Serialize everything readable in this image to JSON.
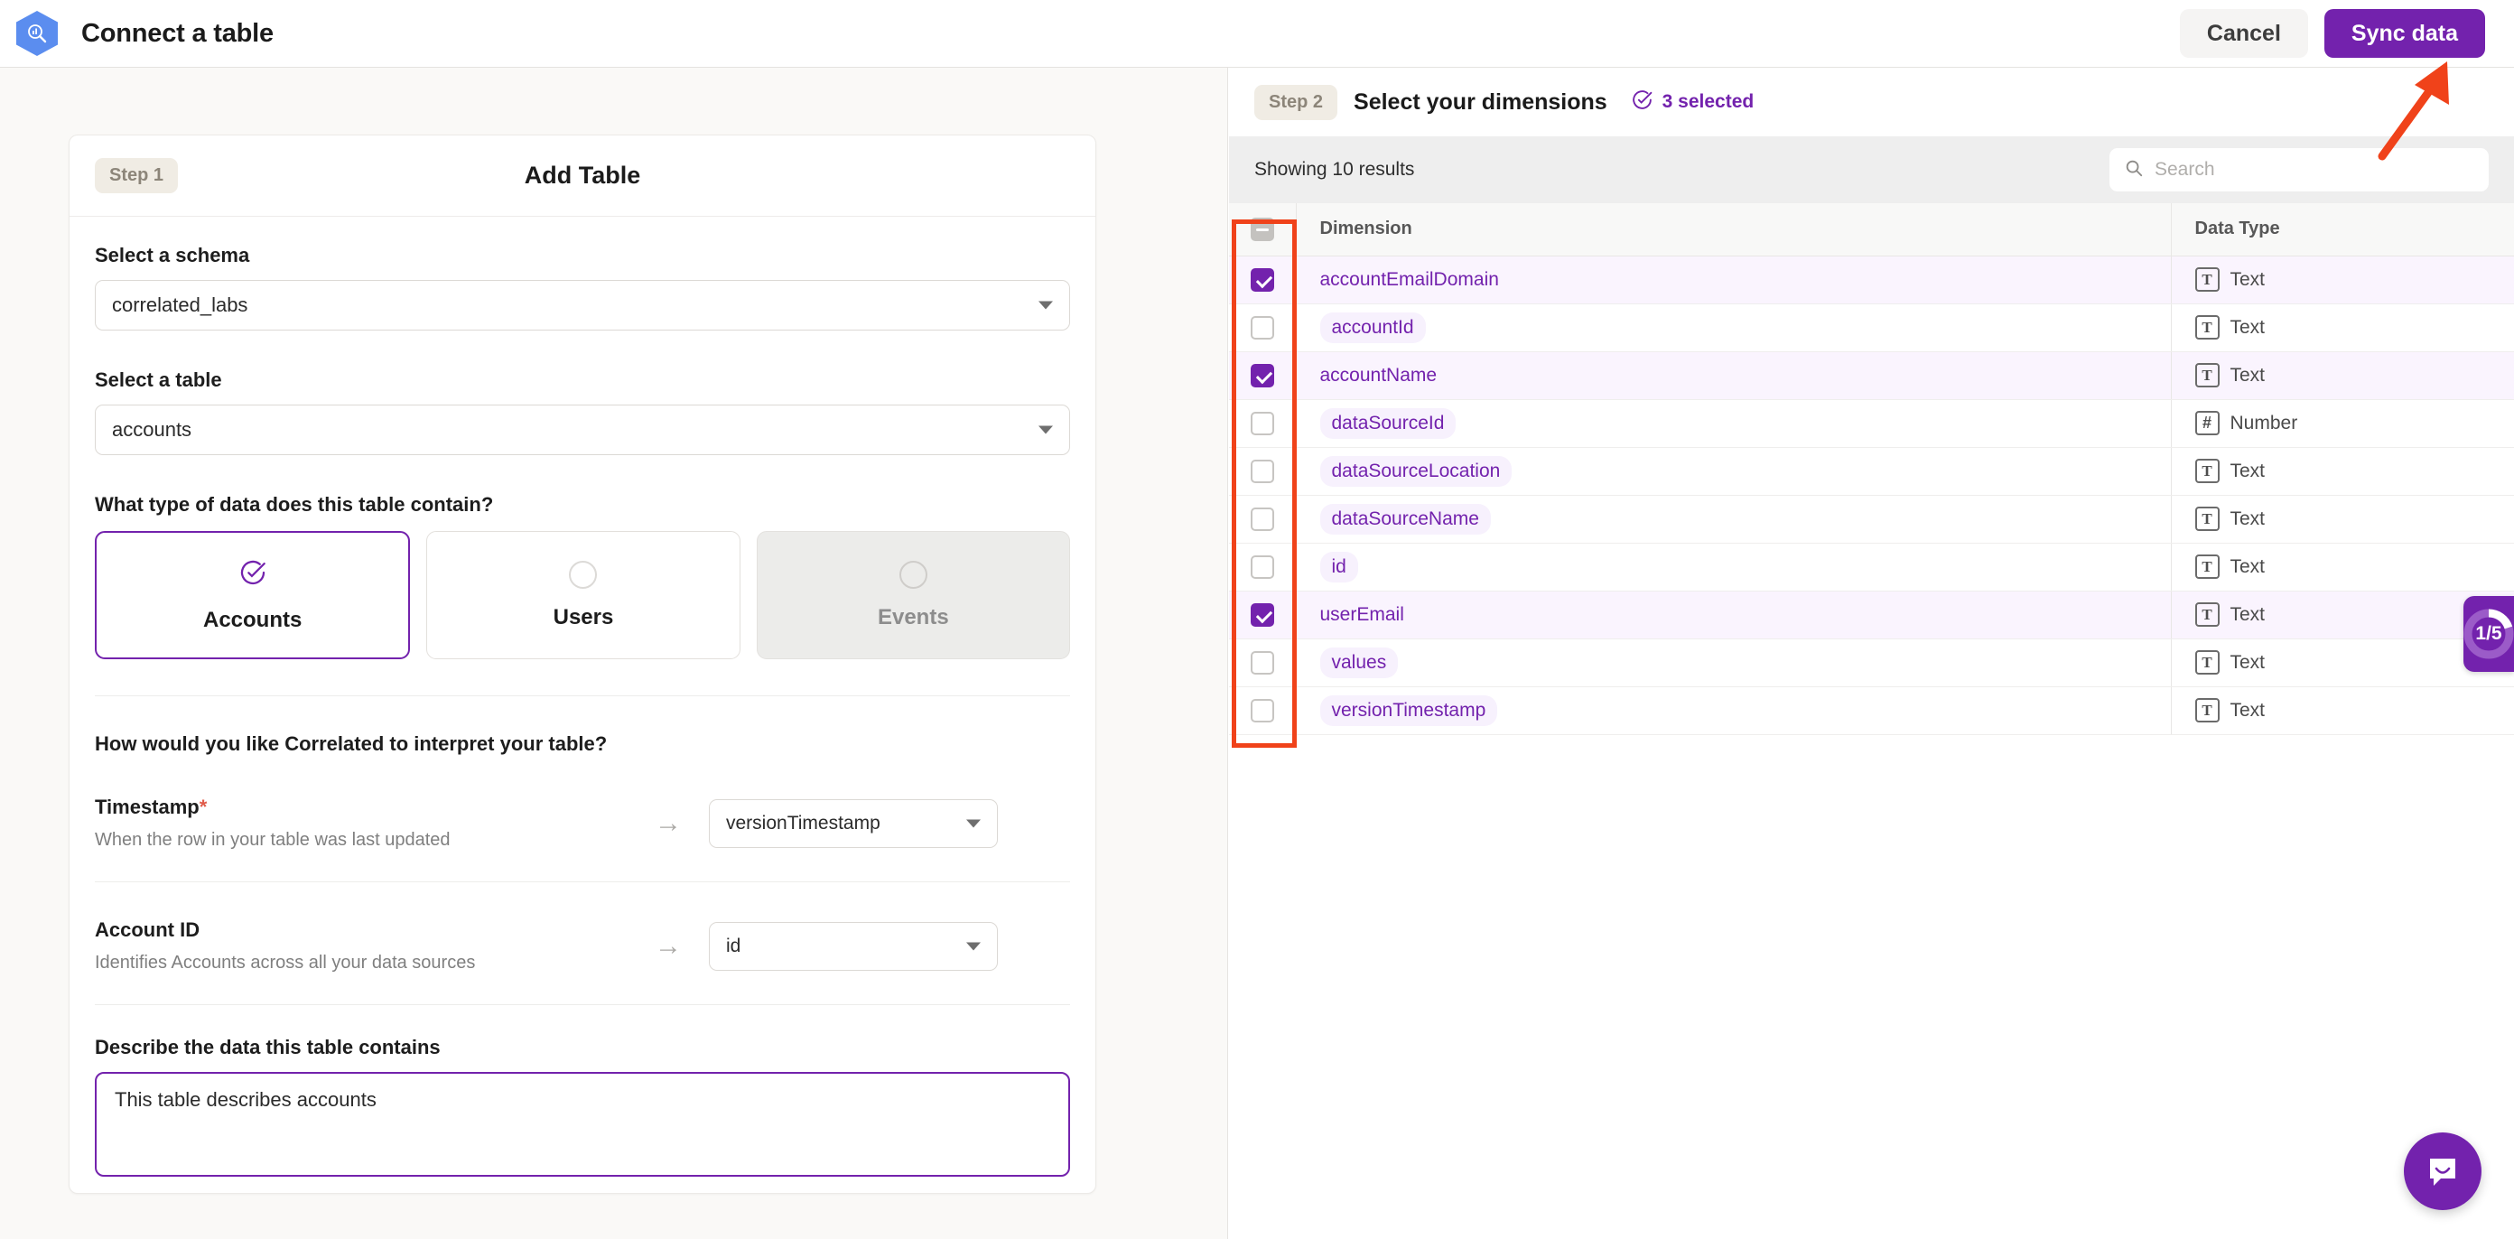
{
  "topbar": {
    "logo_icon": "correlated-hexagon-logo-icon",
    "title": "Connect a table",
    "cancel_label": "Cancel",
    "sync_label": "Sync data"
  },
  "colors": {
    "accent": "#7322ad",
    "accent_light": "#faf4fe",
    "pill_bg": "#f7f1fd",
    "annotation": "#f0421a",
    "logo_blue": "#5b8def",
    "required_red": "#e05b4a"
  },
  "left_panel": {
    "step_badge": "Step 1",
    "card_title": "Add Table",
    "schema": {
      "label": "Select a schema",
      "value": "correlated_labs"
    },
    "table": {
      "label": "Select a table",
      "value": "accounts"
    },
    "data_type": {
      "question": "What type of data does this table contain?",
      "options": [
        {
          "label": "Accounts",
          "state": "selected"
        },
        {
          "label": "Users",
          "state": "enabled"
        },
        {
          "label": "Events",
          "state": "disabled"
        }
      ]
    },
    "interpret": {
      "title": "How would you like Correlated to interpret your table?",
      "mappings": [
        {
          "name": "Timestamp",
          "required": true,
          "description": "When the row in your table was last updated",
          "value": "versionTimestamp"
        },
        {
          "name": "Account ID",
          "required": false,
          "description": "Identifies Accounts across all your data sources",
          "value": "id"
        }
      ]
    },
    "describe": {
      "label": "Describe the data this table contains",
      "value": "This table describes accounts",
      "placeholder": ""
    }
  },
  "right_panel": {
    "step_badge": "Step 2",
    "title": "Select your dimensions",
    "selected_text": "3 selected",
    "selected_icon": "check-circle-icon",
    "results_text": "Showing 10 results",
    "search": {
      "placeholder": "Search",
      "value": "",
      "icon": "search-icon"
    },
    "table": {
      "header_checkbox_state": "indeterminate",
      "columns": [
        "Dimension",
        "Data Type"
      ],
      "rows": [
        {
          "checked": true,
          "dimension": "accountEmailDomain",
          "data_type": "Text",
          "type_icon": "text-type-icon"
        },
        {
          "checked": false,
          "dimension": "accountId",
          "data_type": "Text",
          "type_icon": "text-type-icon"
        },
        {
          "checked": true,
          "dimension": "accountName",
          "data_type": "Text",
          "type_icon": "text-type-icon"
        },
        {
          "checked": false,
          "dimension": "dataSourceId",
          "data_type": "Number",
          "type_icon": "number-type-icon"
        },
        {
          "checked": false,
          "dimension": "dataSourceLocation",
          "data_type": "Text",
          "type_icon": "text-type-icon"
        },
        {
          "checked": false,
          "dimension": "dataSourceName",
          "data_type": "Text",
          "type_icon": "text-type-icon"
        },
        {
          "checked": false,
          "dimension": "id",
          "data_type": "Text",
          "type_icon": "text-type-icon"
        },
        {
          "checked": true,
          "dimension": "userEmail",
          "data_type": "Text",
          "type_icon": "text-type-icon"
        },
        {
          "checked": false,
          "dimension": "values",
          "data_type": "Text",
          "type_icon": "text-type-icon"
        },
        {
          "checked": false,
          "dimension": "versionTimestamp",
          "data_type": "Text",
          "type_icon": "text-type-icon"
        }
      ]
    }
  },
  "widgets": {
    "progress_label": "1/5",
    "progress_current": 1,
    "progress_total": 5,
    "chat_icon": "chat-smile-icon"
  },
  "annotations": {
    "highlight_region": "checkbox-column",
    "arrow_points_to": "sync-data-button"
  }
}
